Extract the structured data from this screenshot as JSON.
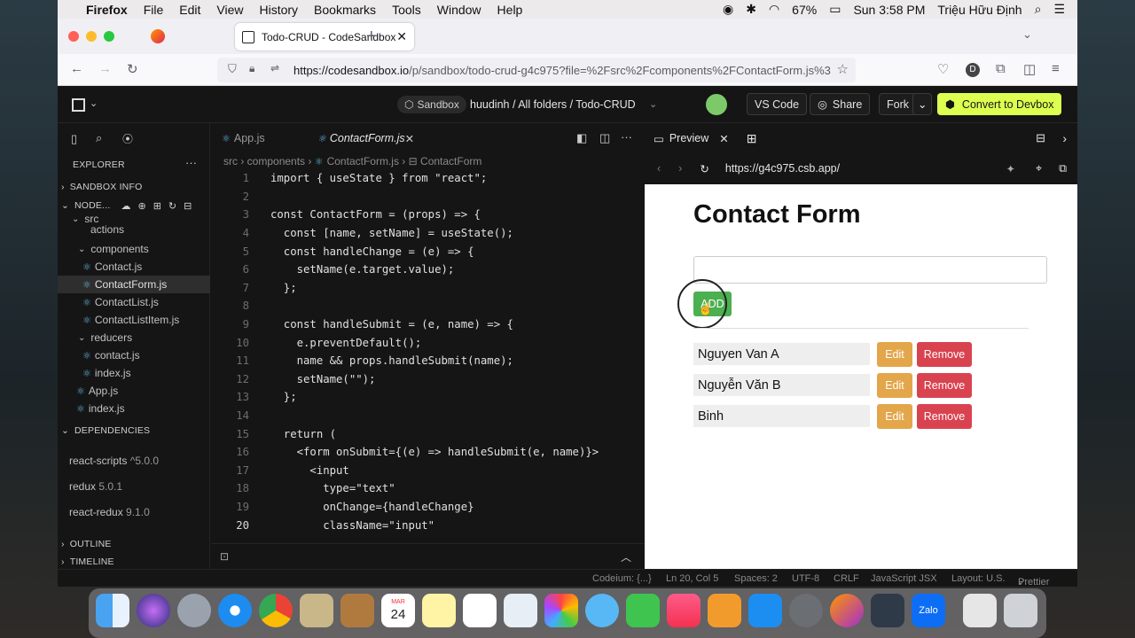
{
  "menubar": {
    "app": "Firefox",
    "items": [
      "File",
      "Edit",
      "View",
      "History",
      "Bookmarks",
      "Tools",
      "Window",
      "Help"
    ],
    "battery": "67%",
    "clock": "Sun 3:58 PM",
    "user": "Triệu Hữu Định"
  },
  "browser": {
    "tab_title": "Todo-CRUD - CodeSandbox",
    "url_host": "https://codesandbox.io",
    "url_path": "/p/sandbox/todo-crud-g4c975?file=%2Fsrc%2Fcomponents%2FContactForm.js%3"
  },
  "csb_top": {
    "sandbox_badge": "Sandbox",
    "breadcrumb": "huudinh / All folders / Todo-CRUD",
    "vscode": "VS Code",
    "share": "Share",
    "fork": "Fork",
    "convert": "Convert to Devbox"
  },
  "sidebar": {
    "explorer": "EXPLORER",
    "sandbox_info": "SANDBOX INFO",
    "node_section": "NODE...",
    "tree": [
      {
        "label": "src"
      },
      {
        "label": "actions"
      },
      {
        "label": "components"
      },
      {
        "label": "Contact.js"
      },
      {
        "label": "ContactForm.js"
      },
      {
        "label": "ContactList.js"
      },
      {
        "label": "ContactListItem.js"
      },
      {
        "label": "reducers"
      },
      {
        "label": "contact.js"
      },
      {
        "label": "index.js"
      },
      {
        "label": "App.js"
      },
      {
        "label": "index.js"
      }
    ],
    "dependencies": "DEPENDENCIES",
    "deps": [
      {
        "name": "react-scripts",
        "version": "^5.0.0"
      },
      {
        "name": "redux",
        "version": "5.0.1"
      },
      {
        "name": "react-redux",
        "version": "9.1.0"
      }
    ],
    "outline": "OUTLINE",
    "timeline": "TIMELINE"
  },
  "editor": {
    "tab_app": "App.js",
    "tab_form": "ContactForm.js",
    "crumb_src": "src",
    "crumb_components": "components",
    "crumb_file": "ContactForm.js",
    "crumb_symbol": "ContactForm",
    "lines": [
      {
        "n": "1",
        "t": "import { useState } from \"react\";"
      },
      {
        "n": "2",
        "t": ""
      },
      {
        "n": "3",
        "t": "const ContactForm = (props) => {"
      },
      {
        "n": "4",
        "t": "  const [name, setName] = useState();"
      },
      {
        "n": "5",
        "t": "  const handleChange = (e) => {"
      },
      {
        "n": "6",
        "t": "    setName(e.target.value);"
      },
      {
        "n": "7",
        "t": "  };"
      },
      {
        "n": "8",
        "t": ""
      },
      {
        "n": "9",
        "t": "  const handleSubmit = (e, name) => {"
      },
      {
        "n": "10",
        "t": "    e.preventDefault();"
      },
      {
        "n": "11",
        "t": "    name && props.handleSubmit(name);"
      },
      {
        "n": "12",
        "t": "    setName(\"\");"
      },
      {
        "n": "13",
        "t": "  };"
      },
      {
        "n": "14",
        "t": ""
      },
      {
        "n": "15",
        "t": "  return ("
      },
      {
        "n": "16",
        "t": "    <form onSubmit={(e) => handleSubmit(e, name)}>"
      },
      {
        "n": "17",
        "t": "      <input"
      },
      {
        "n": "18",
        "t": "        type=\"text\""
      },
      {
        "n": "19",
        "t": "        onChange={handleChange}"
      },
      {
        "n": "20",
        "t": "        className=\"input\""
      }
    ]
  },
  "preview": {
    "label": "Preview",
    "url": "https://g4c975.csb.app/",
    "title": "Contact Form",
    "add": "ADD",
    "contacts": [
      {
        "name": "Nguyen Van A"
      },
      {
        "name": "Nguyễn Văn B"
      },
      {
        "name": "Binh"
      }
    ],
    "edit": "Edit",
    "remove": "Remove"
  },
  "status": {
    "codeium": "Codeium: {...}",
    "position": "Ln 20, Col 5",
    "spaces": "Spaces: 2",
    "encoding": "UTF-8",
    "eol": "CRLF",
    "language": "JavaScript JSX",
    "layout": "Layout: U.S.",
    "prettier": "Prettier"
  },
  "dock": {
    "calendar_month": "MAR",
    "calendar_day": "24",
    "zalo": "Zalo"
  }
}
